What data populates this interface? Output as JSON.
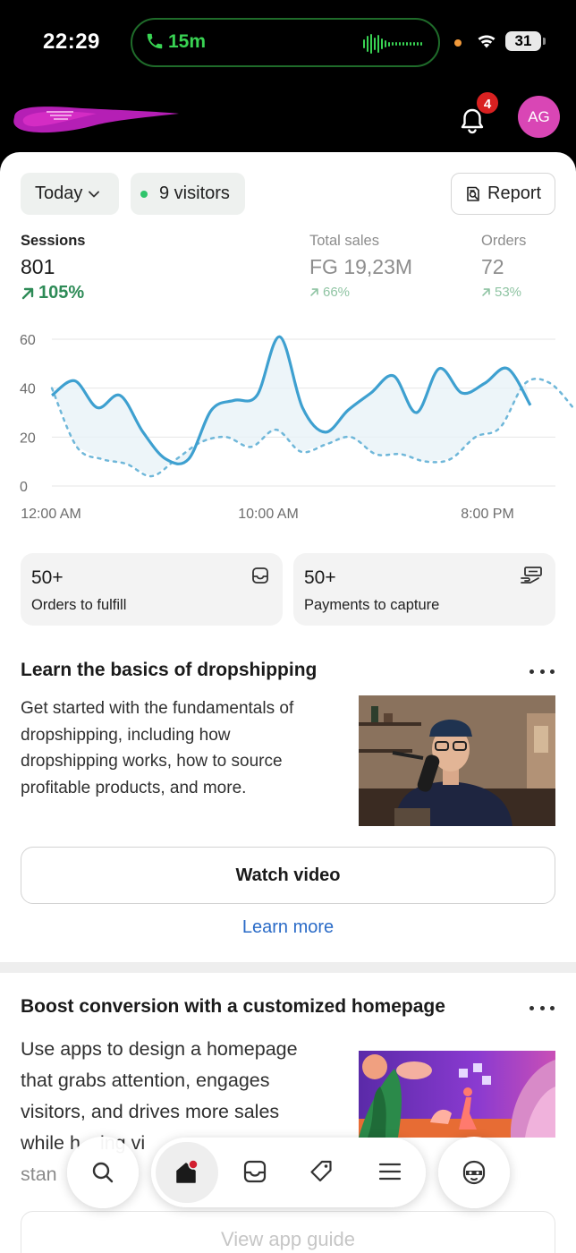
{
  "status_bar": {
    "time": "22:29",
    "call_duration": "15m",
    "battery": "31"
  },
  "header": {
    "notification_count": "4",
    "avatar_initials": "AG"
  },
  "filters": {
    "date_range": "Today",
    "visitors": "9 visitors",
    "report_label": "Report"
  },
  "metrics": {
    "sessions": {
      "label": "Sessions",
      "value": "801",
      "change": "105%"
    },
    "total_sales": {
      "label": "Total sales",
      "value": "FG 19,23M",
      "change": "66%"
    },
    "orders": {
      "label": "Orders",
      "value": "72",
      "change": "53%"
    }
  },
  "chart_data": {
    "type": "line",
    "x_tick_labels": [
      "12:00 AM",
      "10:00 AM",
      "8:00 PM"
    ],
    "y_tick_labels": [
      "60",
      "40",
      "20",
      "0"
    ],
    "ylim": [
      0,
      60
    ],
    "grid": true,
    "series": [
      {
        "style": "solid",
        "color": "#3ea0d0",
        "values": [
          37,
          43,
          32,
          37,
          22,
          11,
          11,
          31,
          35,
          37,
          61,
          32,
          22,
          31,
          38,
          45,
          30,
          48,
          38,
          42,
          48,
          33
        ]
      },
      {
        "style": "dashed",
        "color": "#6fb7d9",
        "values": [
          40,
          16,
          11,
          9,
          4,
          11,
          18,
          20,
          16,
          23,
          14,
          17,
          20,
          13,
          13,
          10,
          11,
          20,
          24,
          42,
          42,
          31
        ]
      }
    ]
  },
  "cards": {
    "fulfill": {
      "count": "50+",
      "label": "Orders to fulfill"
    },
    "capture": {
      "count": "50+",
      "label": "Payments to capture"
    }
  },
  "learn_section": {
    "title": "Learn the basics of dropshipping",
    "body_lines": [
      "Get started with the fundamentals of",
      "dropshipping, including how",
      "dropshipping works, how to source",
      "profitable products, and more."
    ],
    "watch_label": "Watch video",
    "learn_more_label": "Learn more"
  },
  "boost_section": {
    "title": "Boost conversion with a customized homepage",
    "body_lines": [
      "Use apps to design a homepage",
      "that grabs attention, engages",
      "visitors, and drives more sales",
      "while h",
      "ing vi",
      "stan"
    ],
    "guide_label": "View app guide"
  },
  "icons": {
    "nav_left": "search-icon",
    "nav_pill": [
      "home-icon",
      "inbox-icon",
      "tag-icon",
      "menu-icon"
    ],
    "nav_right": "assistant-icon"
  }
}
